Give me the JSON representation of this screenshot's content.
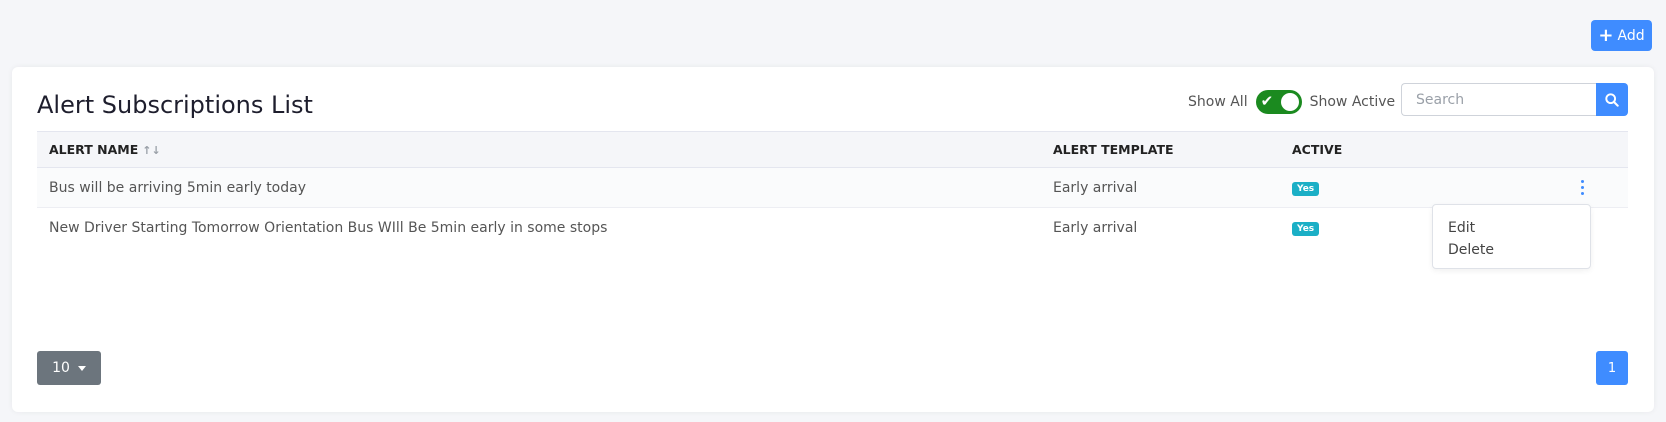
{
  "header": {
    "add_label": "Add"
  },
  "card": {
    "title": "Alert Subscriptions List",
    "toggle": {
      "left_label": "Show All",
      "right_label": "Show Active",
      "checked": true
    },
    "search": {
      "placeholder": "Search",
      "value": ""
    }
  },
  "table": {
    "columns": [
      "ALERT NAME",
      "ALERT TEMPLATE",
      "ACTIVE"
    ],
    "rows": [
      {
        "name": "Bus will be arriving 5min early today",
        "template": "Early arrival",
        "active": "Yes"
      },
      {
        "name": "New Driver Starting Tomorrow Orientation Bus WIll Be 5min early in some stops",
        "template": "Early arrival",
        "active": "Yes"
      }
    ]
  },
  "menu": {
    "items": [
      "Edit",
      "Delete"
    ]
  },
  "footer": {
    "page_size": "10",
    "page": "1"
  },
  "colors": {
    "primary": "#3f8cff",
    "toggle_on": "#1b8a1f",
    "badge": "#1bafc6",
    "page_size_btn": "#6c757d"
  },
  "icons": {
    "add": "plus-icon",
    "search": "search-icon",
    "sort": "sort-arrows-icon",
    "menu": "kebab-icon",
    "toggle": "check-icon",
    "dropdown": "caret-down-icon"
  }
}
